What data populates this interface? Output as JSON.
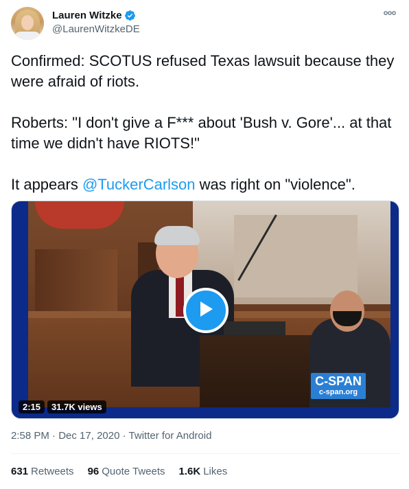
{
  "user": {
    "display_name": "Lauren Witzke",
    "handle": "@LaurenWitzkeDE",
    "verified": true
  },
  "header": {
    "more_icon": "ellipsis-icon"
  },
  "tweet": {
    "line1": "Confirmed: SCOTUS refused Texas lawsuit because they were afraid of riots.",
    "line2": "Roberts: \"I don't give a F*** about 'Bush v. Gore'... at that time we didn't have RIOTS!\"",
    "line3_prefix": "It appears ",
    "line3_mention": "@TuckerCarlson",
    "line3_suffix": " was right on \"violence\"."
  },
  "media": {
    "duration": "2:15",
    "views": "31.7K views",
    "watermark_logo": "C-SPAN",
    "watermark_url": "c-span.org",
    "play_icon": "play-icon"
  },
  "meta": {
    "time": "2:58 PM",
    "date": "Dec 17, 2020",
    "source": "Twitter for Android",
    "separator": "·"
  },
  "stats": {
    "retweets_count": "631",
    "retweets_label": "Retweets",
    "quotes_count": "96",
    "quotes_label": "Quote Tweets",
    "likes_count": "1.6K",
    "likes_label": "Likes"
  },
  "colors": {
    "accent": "#1d9bf0",
    "text_primary": "#0f1419",
    "text_secondary": "#536471"
  }
}
